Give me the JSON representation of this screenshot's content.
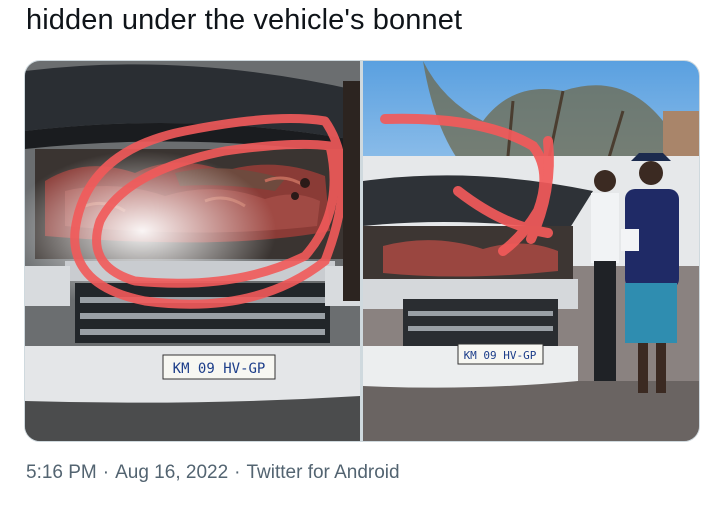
{
  "tweet": {
    "text": "hidden under the vehicle's bonnet",
    "time": "5:16 PM",
    "separator": "·",
    "date": "Aug 16, 2022",
    "source": "Twitter for Android"
  },
  "media": {
    "left_photo": {
      "plate": "KM 09 HV-GP"
    },
    "right_photo": {
      "plate": "KM 09 HV-GP"
    },
    "annotation_color": "#f25a5a"
  }
}
